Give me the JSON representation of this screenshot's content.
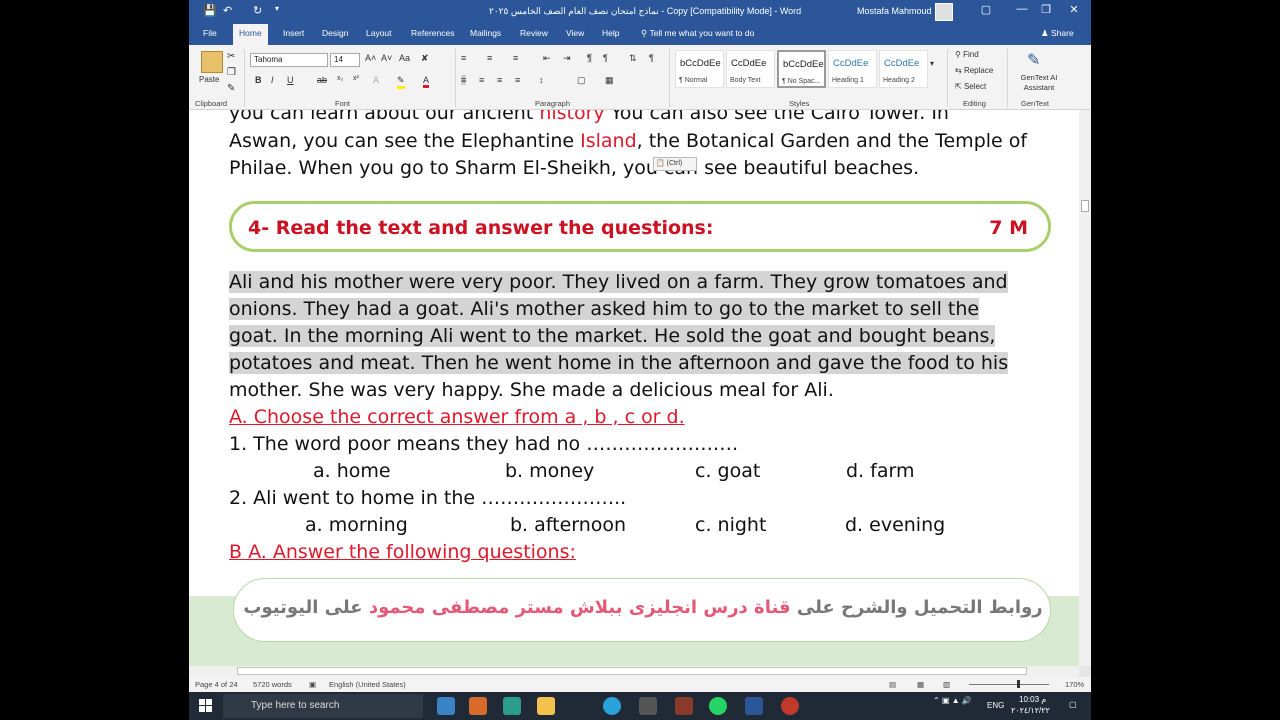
{
  "window": {
    "title": "نماذج امتحان نصف العام الصف الخامس ٢٠٢٥ - Copy [Compatibility Mode] - Word",
    "user": "Mostafa Mahmoud"
  },
  "tabs": [
    "File",
    "Home",
    "Insert",
    "Design",
    "Layout",
    "References",
    "Mailings",
    "Review",
    "View",
    "Help"
  ],
  "tell_me": "Tell me what you want to do",
  "share": "Share",
  "ribbon": {
    "paste": "Paste",
    "font_name": "Tahoma",
    "font_size": "14",
    "groups": [
      "Clipboard",
      "Font",
      "Paragraph",
      "Styles",
      "Editing",
      "GenText"
    ],
    "styles": [
      {
        "sample": "bCcDdEe",
        "name": "¶ Normal"
      },
      {
        "sample": "CcDdEe",
        "name": "Body Text"
      },
      {
        "sample": "bCcDdEe",
        "name": "¶ No Spac..."
      },
      {
        "sample": "CcDdEe",
        "name": "Heading 1"
      },
      {
        "sample": "CcDdEe",
        "name": "Heading 2"
      }
    ],
    "find": "Find",
    "replace": "Replace",
    "select": "Select",
    "gentext": "GenText AI Assistant"
  },
  "document": {
    "line1_a": "you can learn about our ancient ",
    "line1_b": "history",
    "line1_c": " You can also see the Cairo Tower. In",
    "line2_a": "Aswan, you can see the Elephantine ",
    "line2_b": "Island",
    "line2_c": ", the Botanical Garden and the Temple of",
    "line3": "Philae. When you go to Sharm El-Sheikh, you can see beautiful beaches.",
    "paste_options": "(Ctrl)",
    "question_title": "4- Read the text and answer the questions:",
    "question_marks": "7 M",
    "passage": [
      "Ali and his mother were very poor. They lived on a farm. They grow tomatoes and",
      "onions. They had a goat. Ali's mother asked him to go to the market to sell the",
      "goat. In the morning Ali went to the market. He sold the goat and bought beans,",
      "potatoes and meat. Then he went home in the afternoon and gave the food to his",
      "mother. She was very happy. She made a delicious meal for Ali."
    ],
    "section_a": "A. Choose the correct answer from a , b , c or d.",
    "q1": "1. The word poor means they had no ……………………",
    "q1_options": [
      "a. home",
      "b. money",
      "c. goat",
      "d. farm"
    ],
    "q2": "2. Ali went to home in the …………………..",
    "q2_options": [
      "a. morning",
      "b. afternoon",
      "c. night",
      "d. evening"
    ],
    "section_b": "B A. Answer the following questions: ",
    "banner_gray1": "روابط التحميل والشرح على",
    "banner_pink": "قناة درس انجليزى ببلاش مستر مصطفى محمود",
    "banner_gray2": "على اليوتيوب"
  },
  "status": {
    "page": "Page 4 of 24",
    "words": "5720 words",
    "language": "English (United States)",
    "zoom": "170%"
  },
  "taskbar": {
    "search": "Type here to search",
    "lang": "ENG",
    "time": "10:03 م",
    "date": "٢٠٢٤/١٢/٢٢"
  },
  "colors": {
    "word_blue": "#2b579a",
    "question_red": "#cc1122",
    "box_green": "#a9cf6b"
  }
}
